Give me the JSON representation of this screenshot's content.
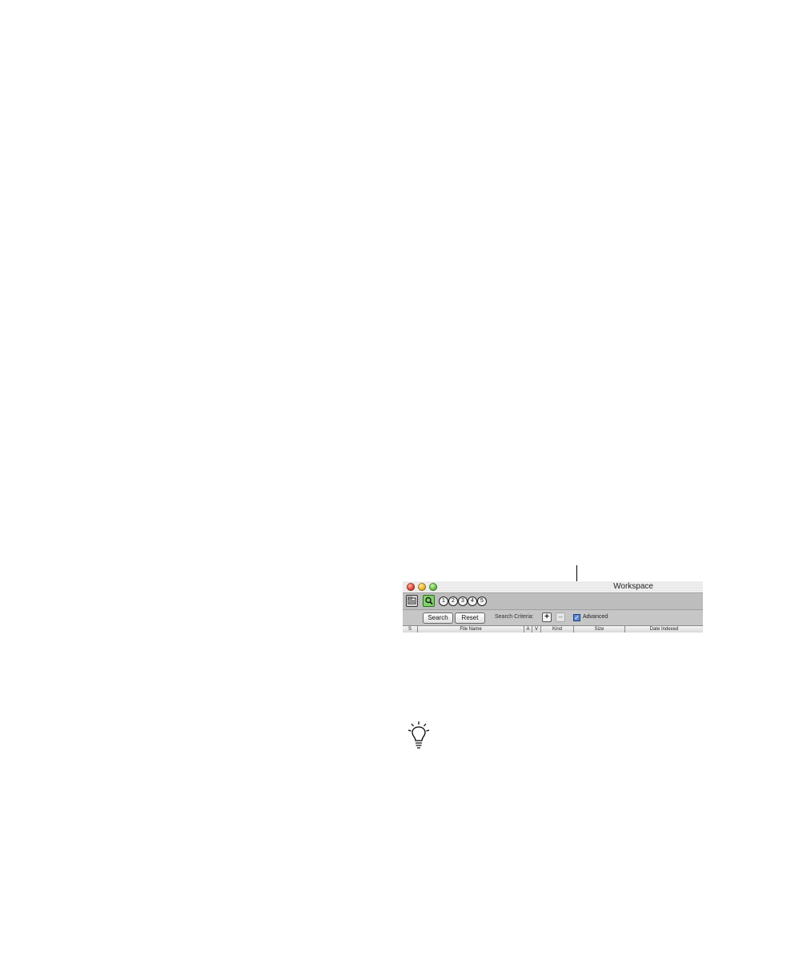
{
  "window": {
    "title": "Workspace"
  },
  "toolbar": {
    "views": [
      "1",
      "2",
      "3",
      "4",
      "5"
    ]
  },
  "search_bar": {
    "search_label": "Search",
    "reset_label": "Reset",
    "criteria_label": "Search Criteria:",
    "add_label": "+",
    "remove_label": "–",
    "advanced_label": "Advanced",
    "advanced_checked": true,
    "advanced_mark": "✓"
  },
  "table": {
    "columns": [
      "S",
      "File Name",
      "A",
      "V",
      "Kind",
      "Size",
      "Date Indexed"
    ]
  }
}
